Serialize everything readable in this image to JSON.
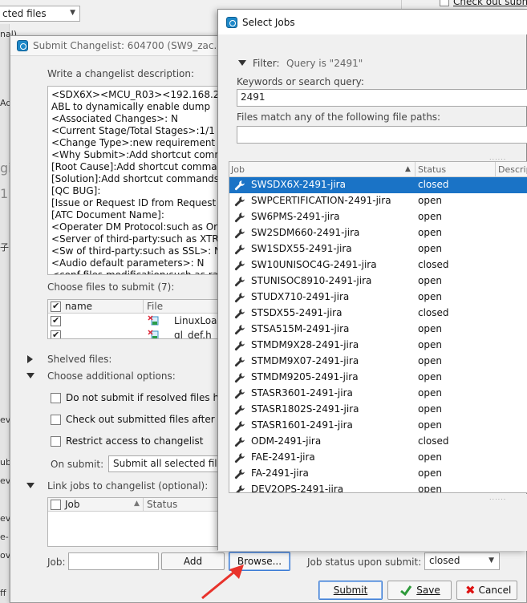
{
  "background": {
    "combo_text": "cted files",
    "fragments": [
      "nal)",
      "Ad",
      "gi",
      "1",
      "子",
      "ev",
      "ub",
      "ev",
      "ev",
      "e-",
      "ov",
      "ff"
    ],
    "checkout_label": "Check out submit"
  },
  "submit_dialog": {
    "title": "Submit Changelist: 604700 (SW9_zac.che",
    "description_label": "Write a changelist description:",
    "description_lines": [
      "<SDX6X><MCU_R03><192.168.2",
      "ABL to dynamically enable dump",
      "<Associated Changes>: N",
      "<Current Stage/Total Stages>:1/1",
      "<Change Type>:new requirement",
      "<Why Submit>:Add shortcut comm",
      "[Root Cause]:Add shortcut comma",
      "[Solution]:Add shortcut commands",
      "[QC BUG]:",
      "[Issue or Request ID from Request",
      "[ATC Document Name]:",
      "<Operater DM Protocol:such as Or",
      "<Server of third-party:such as XTR",
      "<Sw of third-party:such as SSL>: N",
      "<Audio default parameters>: N",
      "<conf files modification:such as ra"
    ],
    "files_label": "Choose files to submit (7):",
    "files_header": {
      "name": "name",
      "file": "File"
    },
    "files": [
      {
        "name": "LinuxLoad"
      },
      {
        "name": "gl_def.h"
      }
    ],
    "shelved_label": "Shelved files:",
    "additional_label": "Choose additional options:",
    "options": [
      {
        "label": "Do not submit if resolved files h"
      },
      {
        "label": "Check out submitted files after s"
      },
      {
        "label": "Restrict access to changelist"
      }
    ],
    "on_submit_label": "On submit:",
    "on_submit_value": "Submit all selected file",
    "link_jobs_label": "Link jobs to changelist (optional):",
    "jobs_header": {
      "job": "Job",
      "status": "Status"
    },
    "job_label": "Job:",
    "job_value": "",
    "add_label": "Add",
    "browse_label": "Browse...",
    "job_status_label": "Job status upon submit:",
    "job_status_value": "closed",
    "submit_label": "Submit",
    "save_label": "Save",
    "cancel_label": "Cancel"
  },
  "select_jobs": {
    "title": "Select Jobs",
    "filter_label": "Filter:",
    "filter_summary": "Query is \"2491\"",
    "keywords_label": "Keywords or search query:",
    "keywords_value": "2491",
    "paths_label": "Files match any of the following file paths:",
    "paths_value": "",
    "columns": {
      "job": "Job",
      "status": "Status",
      "description": "Descrip"
    },
    "selected_index": 0,
    "rows": [
      {
        "job": "SWSDX6X-2491-jira",
        "status": "closed"
      },
      {
        "job": "SWPCERTIFICATION-2491-jira",
        "status": "open"
      },
      {
        "job": "SW6PMS-2491-jira",
        "status": "open"
      },
      {
        "job": "SW2SDM660-2491-jira",
        "status": "open"
      },
      {
        "job": "SW1SDX55-2491-jira",
        "status": "open"
      },
      {
        "job": "SW10UNISOC4G-2491-jira",
        "status": "closed"
      },
      {
        "job": "STUNISOC8910-2491-jira",
        "status": "open"
      },
      {
        "job": "STUDX710-2491-jira",
        "status": "open"
      },
      {
        "job": "STSDX55-2491-jira",
        "status": "closed"
      },
      {
        "job": "STSA515M-2491-jira",
        "status": "open"
      },
      {
        "job": "STMDM9X28-2491-jira",
        "status": "open"
      },
      {
        "job": "STMDM9X07-2491-jira",
        "status": "open"
      },
      {
        "job": "STMDM9205-2491-jira",
        "status": "open"
      },
      {
        "job": "STASR3601-2491-jira",
        "status": "open"
      },
      {
        "job": "STASR1802S-2491-jira",
        "status": "open"
      },
      {
        "job": "STASR1601-2491-jira",
        "status": "open"
      },
      {
        "job": "ODM-2491-jira",
        "status": "closed"
      },
      {
        "job": "FAE-2491-jira",
        "status": "open"
      },
      {
        "job": "FA-2491-jira",
        "status": "open"
      },
      {
        "job": "DEV2OPS-2491-jira",
        "status": "open"
      }
    ]
  },
  "colors": {
    "selection": "#1a73c6",
    "annotation_arrow": "#e8322b",
    "app_icon": "#1e88c8"
  }
}
